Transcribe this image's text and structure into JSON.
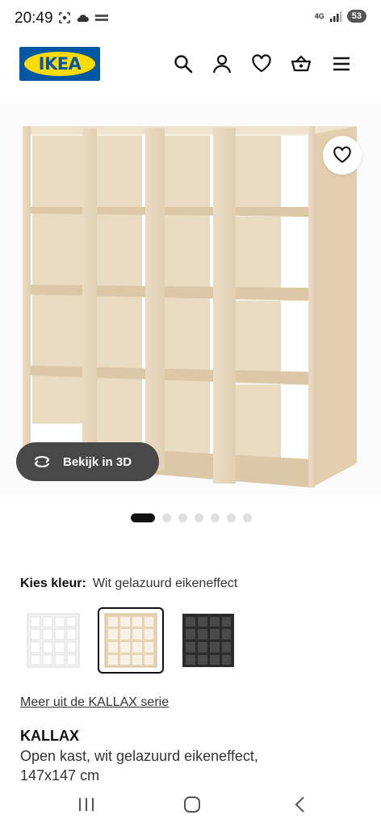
{
  "status_bar": {
    "time": "20:49",
    "network": "4G",
    "battery": "53"
  },
  "header": {
    "logo_text": "IKEA",
    "icons": [
      "search-icon",
      "user-icon",
      "heart-icon",
      "basket-icon",
      "menu-icon"
    ]
  },
  "gallery": {
    "view_3d_label": "Bekijk in 3D",
    "dot_count": 7,
    "active_dot": 0
  },
  "color": {
    "label": "Kies kleur:",
    "value": "Wit gelazuurd eikeneffect",
    "swatches": [
      "wit",
      "wit gelazuurd eikeneffect",
      "zwartbruin"
    ],
    "selected_index": 1,
    "colors": {
      "white": "#f4f4f4",
      "oak": "#e6d3b5",
      "black": "#2b2b2b"
    }
  },
  "series_link": "Meer uit de KALLAX serie",
  "product": {
    "name": "KALLAX",
    "description": "Open kast, wit gelazuurd eikeneffect,",
    "size": "147x147 cm"
  },
  "brand_colors": {
    "ikea_blue": "#0058a3",
    "ikea_yellow": "#ffdb00"
  },
  "nav_bar": {
    "icons": [
      "recent-apps-icon",
      "home-icon",
      "back-icon"
    ]
  }
}
